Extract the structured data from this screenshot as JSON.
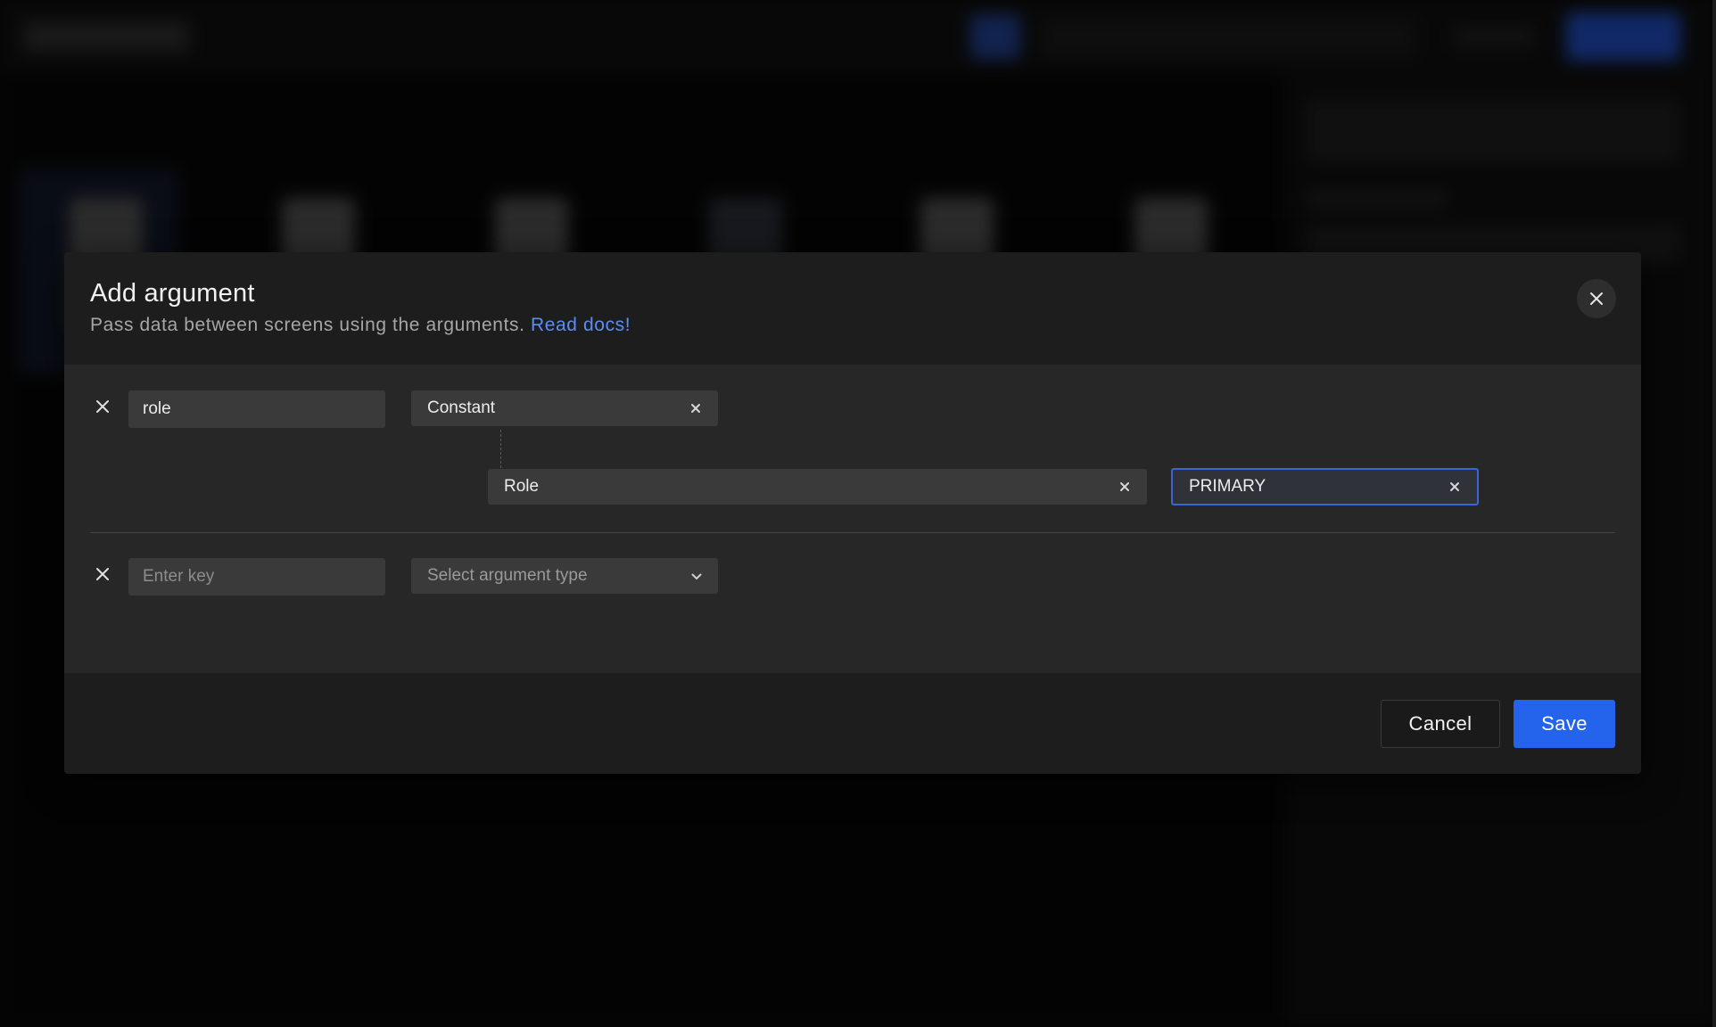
{
  "background_app": {
    "blurred": true
  },
  "modal": {
    "title": "Add argument",
    "subtitle": "Pass data between screens using the arguments.",
    "docs_link": "Read docs!",
    "close_icon": "close-icon"
  },
  "arguments": {
    "row1": {
      "key_value": "role",
      "type_value": "Constant",
      "enum_value": "Role",
      "constant_value": "PRIMARY"
    },
    "row2": {
      "key_placeholder": "Enter key",
      "type_placeholder": "Select argument type"
    }
  },
  "footer": {
    "cancel_label": "Cancel",
    "save_label": "Save"
  },
  "colors": {
    "accent": "#2463ec",
    "link": "#5b8df6",
    "modal_bg": "#1d1d1d",
    "body_bg": "#272727",
    "field_bg": "#3a3a3a",
    "focus_border": "#3a64d8"
  }
}
